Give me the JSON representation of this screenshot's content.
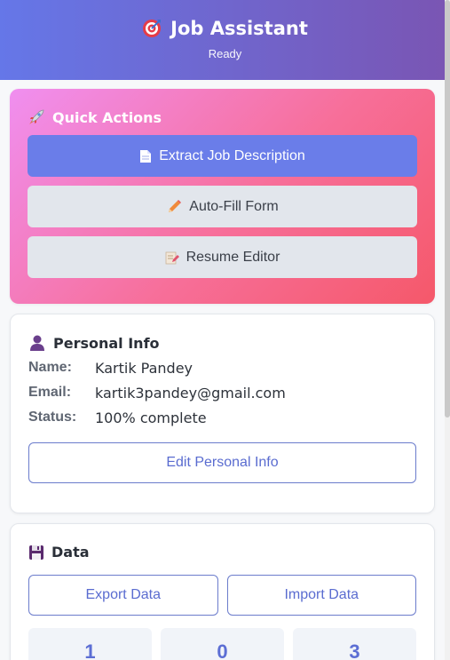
{
  "header": {
    "title": "Job Assistant",
    "status": "Ready",
    "icon": "target-icon",
    "gradient": [
      "#6577e8",
      "#7a55b3"
    ]
  },
  "quick_actions": {
    "title": "Quick Actions",
    "icon": "rocket-icon",
    "buttons": [
      {
        "label": "Extract Job Description",
        "icon": "document-icon",
        "style": "primary",
        "color": "#6a7de9"
      },
      {
        "label": "Auto-Fill Form",
        "icon": "pencil-icon",
        "style": "secondary"
      },
      {
        "label": "Resume Editor",
        "icon": "memo-icon",
        "style": "secondary"
      }
    ]
  },
  "personal_info": {
    "title": "Personal Info",
    "icon": "user-icon",
    "fields": [
      {
        "label": "Name:",
        "value": "Kartik Pandey"
      },
      {
        "label": "Email:",
        "value": "kartik3pandey@gmail.com"
      },
      {
        "label": "Status:",
        "value": "100% complete"
      }
    ],
    "edit_label": "Edit Personal Info"
  },
  "data": {
    "title": "Data",
    "icon": "floppy-disk-icon",
    "export_label": "Export Data",
    "import_label": "Import Data",
    "stats": [
      "1",
      "0",
      "3"
    ]
  }
}
